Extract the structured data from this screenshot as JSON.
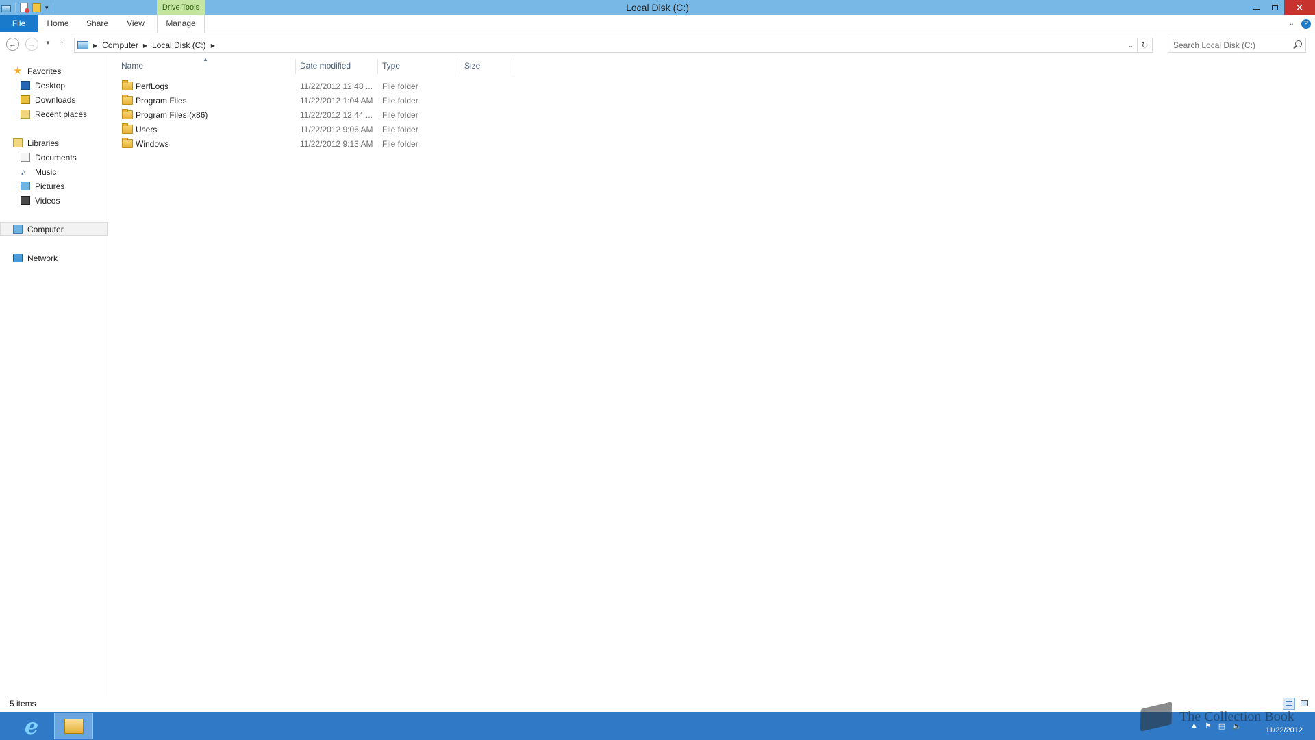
{
  "window": {
    "title": "Local Disk (C:)",
    "contextual_tab_group": "Drive Tools",
    "close_glyph": "✕"
  },
  "ribbon": {
    "tabs": [
      {
        "label": "File"
      },
      {
        "label": "Home"
      },
      {
        "label": "Share"
      },
      {
        "label": "View"
      },
      {
        "label": "Manage"
      }
    ]
  },
  "navbar": {
    "breadcrumbs": [
      "Computer",
      "Local Disk (C:)"
    ],
    "search_placeholder": "Search Local Disk (C:)"
  },
  "navpane": {
    "favorites": {
      "label": "Favorites",
      "items": [
        "Desktop",
        "Downloads",
        "Recent places"
      ]
    },
    "libraries": {
      "label": "Libraries",
      "items": [
        "Documents",
        "Music",
        "Pictures",
        "Videos"
      ]
    },
    "computer": {
      "label": "Computer",
      "selected": true
    },
    "network": {
      "label": "Network"
    }
  },
  "filelist": {
    "columns": [
      "Name",
      "Date modified",
      "Type",
      "Size"
    ],
    "sorted_by": "Name",
    "rows": [
      {
        "name": "PerfLogs",
        "date": "11/22/2012 12:48 ...",
        "type": "File folder",
        "size": ""
      },
      {
        "name": "Program Files",
        "date": "11/22/2012 1:04 AM",
        "type": "File folder",
        "size": ""
      },
      {
        "name": "Program Files (x86)",
        "date": "11/22/2012 12:44 ...",
        "type": "File folder",
        "size": ""
      },
      {
        "name": "Users",
        "date": "11/22/2012 9:06 AM",
        "type": "File folder",
        "size": ""
      },
      {
        "name": "Windows",
        "date": "11/22/2012 9:13 AM",
        "type": "File folder",
        "size": ""
      }
    ]
  },
  "status": {
    "item_count": "5 items"
  },
  "taskbar": {
    "date": "11/22/2012",
    "watermark": "The Collection Book"
  },
  "colors": {
    "titlebar": "#78b8e6",
    "file_tab": "#1979ca",
    "drive_tools": "#c5e6a2",
    "taskbar": "#2f79c7",
    "close_button": "#c7312e"
  }
}
